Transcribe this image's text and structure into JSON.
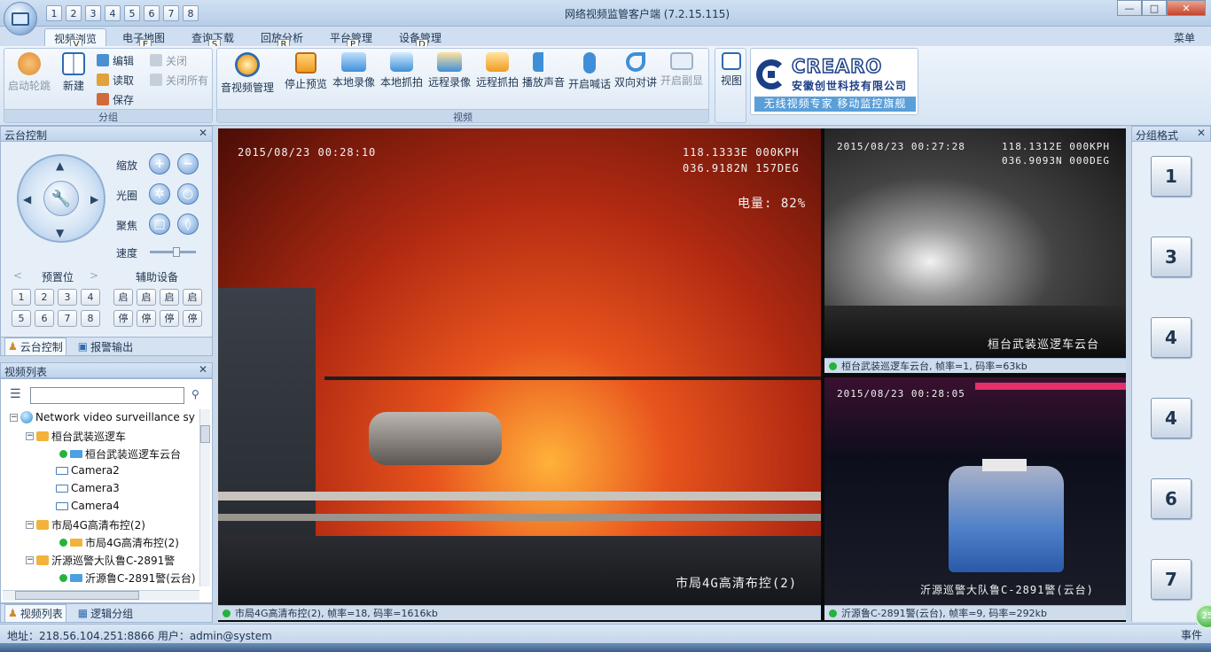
{
  "window": {
    "title": "网络视频监管客户端 (7.2.15.115)",
    "quick_access": [
      "1",
      "2",
      "3",
      "4",
      "5",
      "6",
      "7",
      "8"
    ],
    "controls": {
      "minimize": "—",
      "maximize": "□",
      "close": "✕"
    }
  },
  "ribbon_tabs": [
    {
      "label": "视频浏览",
      "keytip": "V",
      "active": true
    },
    {
      "label": "电子地图",
      "keytip": "E"
    },
    {
      "label": "查询下载",
      "keytip": "S"
    },
    {
      "label": "回放分析",
      "keytip": "R"
    },
    {
      "label": "平台管理",
      "keytip": "P"
    },
    {
      "label": "设备管理",
      "keytip": "D"
    }
  ],
  "menu_label": "菜单",
  "ribbon": {
    "group_section": {
      "label": "分组",
      "start_tour": "启动轮跳",
      "new": "新建",
      "edit": "编辑",
      "read": "读取",
      "save": "保存",
      "close": "关闭",
      "close_all": "关闭所有"
    },
    "video_section": {
      "label": "视频",
      "buttons": [
        "音视频管理",
        "停止预览",
        "本地录像",
        "本地抓拍",
        "远程录像",
        "远程抓拍",
        "播放声音",
        "开启喊话",
        "双向对讲",
        "开启副显"
      ]
    },
    "view_label": "视图"
  },
  "logo": {
    "brand": "CREARO",
    "company": "安徽创世科技有限公司",
    "slogan": "无线视频专家  移动监控旗舰"
  },
  "ptz": {
    "title": "云台控制",
    "zoom": "缩放",
    "iris": "光圈",
    "focus": "聚焦",
    "speed": "速度",
    "preset_label": "预置位",
    "aux_label": "辅助设备",
    "presets": [
      "1",
      "2",
      "3",
      "4",
      "5",
      "6",
      "7",
      "8"
    ],
    "aux_on": "启",
    "aux_off": "停",
    "prev": "<",
    "next": ">",
    "close": "✕"
  },
  "ptz_tabs": {
    "ptz": "云台控制",
    "alarm": "报警输出"
  },
  "video_list": {
    "title": "视频列表",
    "search_value": "",
    "root": "Network video surveillance sy",
    "items": [
      {
        "label": "桓台武装巡逻车"
      },
      {
        "label": "桓台武装巡逻车云台"
      },
      {
        "label": "Camera2"
      },
      {
        "label": "Camera3"
      },
      {
        "label": "Camera4"
      },
      {
        "label": "市局4G高清布控(2)"
      },
      {
        "label": "市局4G高清布控(2)"
      },
      {
        "label": "沂源巡警大队鲁C-2891警"
      },
      {
        "label": "沂源鲁C-2891警(云台)"
      }
    ],
    "close": "✕"
  },
  "list_tabs": {
    "video_list": "视频列表",
    "logic_group": "逻辑分组"
  },
  "videos": {
    "main": {
      "timestamp": "2015/08/23  00:28:10",
      "gps1": "118.1333E 000KPH",
      "gps2": "036.9182N 157DEG",
      "battery": "电量: 82%",
      "caption": "市局4G高清布控(2)",
      "status": "市局4G高清布控(2), 帧率=18, 码率=1616kb"
    },
    "top_right": {
      "timestamp": "2015/08/23  00:27:28",
      "gps1": "118.1312E 000KPH",
      "gps2": "036.9093N 000DEG",
      "caption": "桓台武装巡逻车云台",
      "status": "桓台武装巡逻车云台, 帧率=1, 码率=63kb"
    },
    "bottom_right": {
      "timestamp": "2015/08/23  00:28:05",
      "caption": "沂源巡警大队鲁C-2891警(云台)",
      "status": "沂源鲁C-2891警(云台), 帧率=9, 码率=292kb"
    }
  },
  "layout_panel": {
    "title": "分组格式",
    "options": [
      "1",
      "3",
      "4",
      "4",
      "6",
      "7"
    ],
    "close": "✕"
  },
  "status_bar": {
    "text": "地址：218.56.104.251:8866  用户：admin@system",
    "event": "事件",
    "badge": "25"
  },
  "colors": {
    "accent": "#1b3f87",
    "online": "#25b33e",
    "fire": "#c2431a"
  }
}
